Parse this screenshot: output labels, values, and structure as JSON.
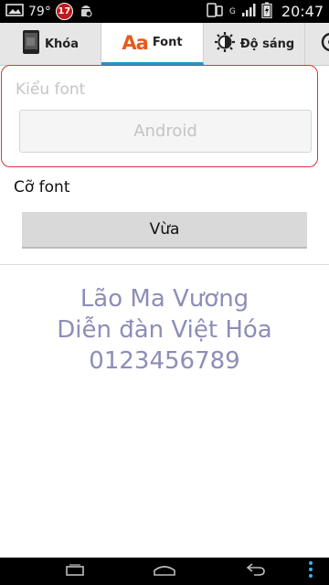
{
  "status_bar": {
    "temperature": "79°",
    "notification_count": "17",
    "time": "20:47",
    "network_letter": "G"
  },
  "tabs": [
    {
      "label": "Khóa",
      "icon": "lock-phone-icon"
    },
    {
      "label": "Font",
      "icon": "font-aa-icon",
      "icon_text": "Aa",
      "active": true
    },
    {
      "label": "Độ sáng",
      "icon": "brightness-icon"
    },
    {
      "label": "",
      "icon": "overflow-tab-icon"
    }
  ],
  "font_style": {
    "label": "Kiểu font",
    "value": "Android"
  },
  "font_size": {
    "label": "Cỡ font",
    "value": "Vừa"
  },
  "preview": {
    "lines": [
      "Lão Ma Vương",
      "Diễn đàn Việt Hóa",
      "0123456789"
    ]
  },
  "colors": {
    "accent": "#1f97c9",
    "font_icon": "#e8591c",
    "preview_text": "#8c8eb7",
    "highlight_border": "#e0333c"
  }
}
